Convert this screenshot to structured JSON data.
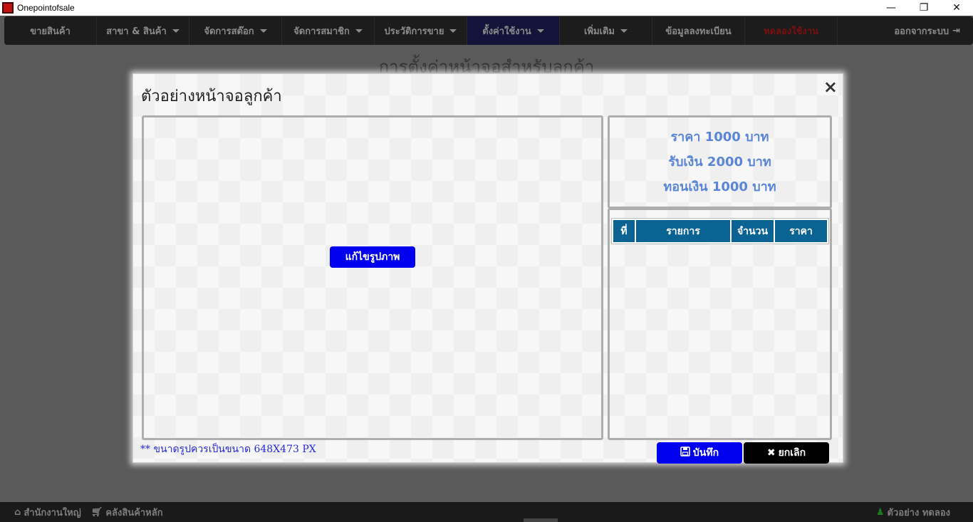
{
  "window": {
    "title": "Onepointofsale",
    "controls": {
      "minimize": "—",
      "restore": "❐",
      "close": "✕"
    }
  },
  "navbar": {
    "items": [
      {
        "label": "ขายสินค้า",
        "has_caret": false
      },
      {
        "label": "สาขา & สินค้า",
        "has_caret": true
      },
      {
        "label": "จัดการสต๊อก",
        "has_caret": true
      },
      {
        "label": "จัดการสมาชิก",
        "has_caret": true
      },
      {
        "label": "ประวัติการขาย",
        "has_caret": true
      },
      {
        "label": "ตั้งค่าใช้งาน",
        "has_caret": true,
        "active": true
      },
      {
        "label": "เพิ่มเติม",
        "has_caret": true
      },
      {
        "label": "ข้อมูลลงทะเบียน",
        "has_caret": false
      },
      {
        "label": "ทดลองใช้งาน",
        "has_caret": false,
        "red": true
      }
    ],
    "logout": {
      "label": "ออกจากระบบ",
      "icon": "sign-out-icon"
    }
  },
  "page": {
    "title": "การตั้งค่าหน้าจอสำหรับลูกค้า"
  },
  "modal": {
    "title": "ตัวอย่างหน้าจอลูกค้า",
    "close_symbol": "×",
    "edit_image_label": "แก้ไขรูปภาพ",
    "price_lines": [
      "ราคา 1000 บาท",
      "รับเงิน 2000 บาท",
      "ทอนเงิน 1000 บาท"
    ],
    "table_headers": [
      "ที่",
      "รายการ",
      "จำนวน",
      "ราคา"
    ],
    "size_note": "** ขนาดรูปควรเป็นขนาด 648X473 PX",
    "save_label": "บันทึก",
    "cancel_label": "ยกเลิก",
    "save_icon": "floppy-disk-icon",
    "cancel_icon": "x-icon"
  },
  "footer": {
    "branch": {
      "label": "สำนักงานใหญ่",
      "icon": "home-icon"
    },
    "warehouse": {
      "label": "คลังสินค้าหลัก",
      "icon": "cart-icon"
    },
    "user": {
      "label": "ตัวอย่าง ทดลอง",
      "icon": "user-icon"
    }
  },
  "colors": {
    "primary_blue": "#0000ee",
    "table_header": "#0b6394",
    "price_text": "#5b86d6",
    "note_text": "#2a2adc"
  }
}
